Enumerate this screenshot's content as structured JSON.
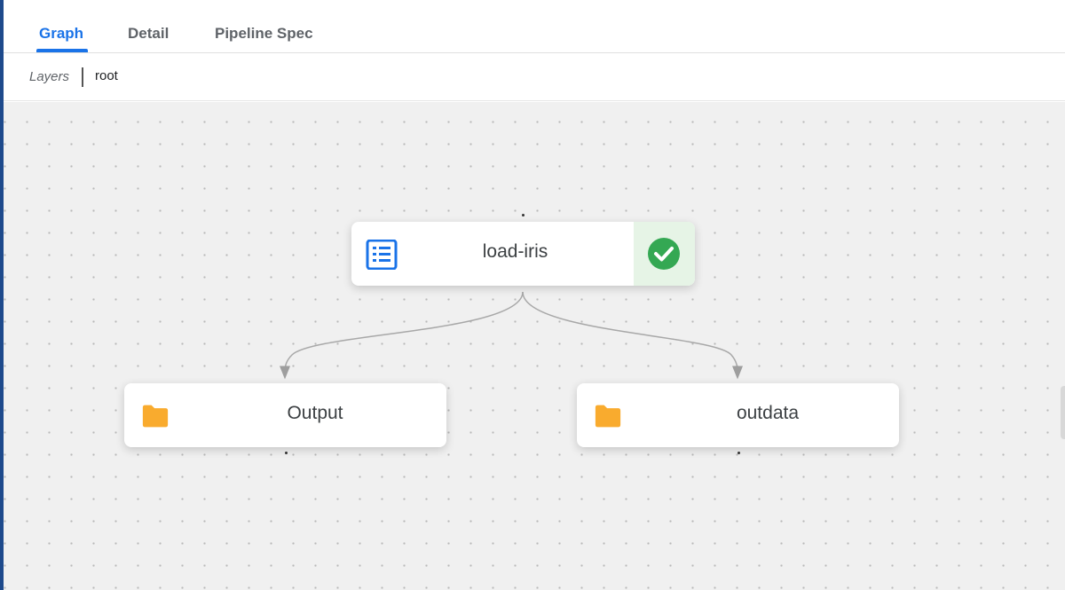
{
  "tabs": [
    {
      "label": "Graph",
      "active": true
    },
    {
      "label": "Detail",
      "active": false
    },
    {
      "label": "Pipeline Spec",
      "active": false
    }
  ],
  "layers": {
    "label": "Layers",
    "path": "root"
  },
  "nodes": {
    "load_iris": {
      "label": "load-iris",
      "icon": "list-document-icon",
      "status": "succeeded",
      "status_icon": "check-circle-icon"
    },
    "output": {
      "label": "Output",
      "icon": "folder-icon"
    },
    "outdata": {
      "label": "outdata",
      "icon": "folder-icon"
    }
  },
  "colors": {
    "accent": "#1a73e8",
    "success": "#34a853",
    "folder": "#f9ab2e",
    "left_strip": "#1e4a8c"
  }
}
